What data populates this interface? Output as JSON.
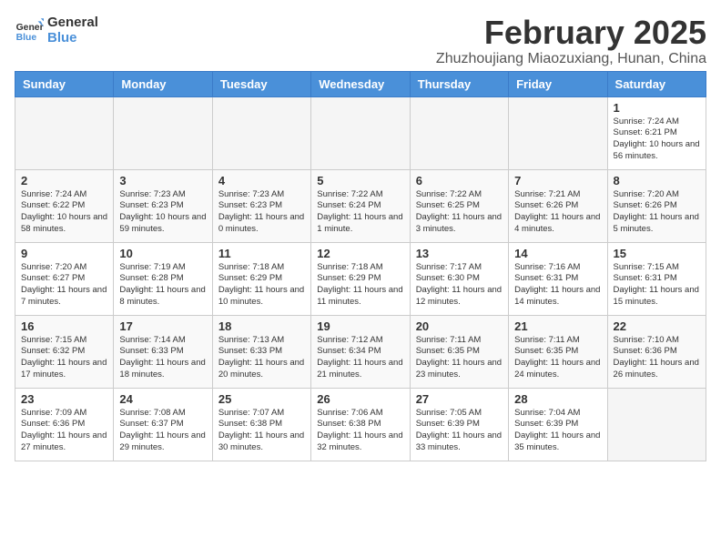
{
  "header": {
    "logo_line1": "General",
    "logo_line2": "Blue",
    "month_year": "February 2025",
    "location": "Zhuzhoujiang Miaozuxiang, Hunan, China"
  },
  "weekdays": [
    "Sunday",
    "Monday",
    "Tuesday",
    "Wednesday",
    "Thursday",
    "Friday",
    "Saturday"
  ],
  "weeks": [
    [
      {
        "day": "",
        "info": ""
      },
      {
        "day": "",
        "info": ""
      },
      {
        "day": "",
        "info": ""
      },
      {
        "day": "",
        "info": ""
      },
      {
        "day": "",
        "info": ""
      },
      {
        "day": "",
        "info": ""
      },
      {
        "day": "1",
        "info": "Sunrise: 7:24 AM\nSunset: 6:21 PM\nDaylight: 10 hours and 56 minutes."
      }
    ],
    [
      {
        "day": "2",
        "info": "Sunrise: 7:24 AM\nSunset: 6:22 PM\nDaylight: 10 hours and 58 minutes."
      },
      {
        "day": "3",
        "info": "Sunrise: 7:23 AM\nSunset: 6:23 PM\nDaylight: 10 hours and 59 minutes."
      },
      {
        "day": "4",
        "info": "Sunrise: 7:23 AM\nSunset: 6:23 PM\nDaylight: 11 hours and 0 minutes."
      },
      {
        "day": "5",
        "info": "Sunrise: 7:22 AM\nSunset: 6:24 PM\nDaylight: 11 hours and 1 minute."
      },
      {
        "day": "6",
        "info": "Sunrise: 7:22 AM\nSunset: 6:25 PM\nDaylight: 11 hours and 3 minutes."
      },
      {
        "day": "7",
        "info": "Sunrise: 7:21 AM\nSunset: 6:26 PM\nDaylight: 11 hours and 4 minutes."
      },
      {
        "day": "8",
        "info": "Sunrise: 7:20 AM\nSunset: 6:26 PM\nDaylight: 11 hours and 5 minutes."
      }
    ],
    [
      {
        "day": "9",
        "info": "Sunrise: 7:20 AM\nSunset: 6:27 PM\nDaylight: 11 hours and 7 minutes."
      },
      {
        "day": "10",
        "info": "Sunrise: 7:19 AM\nSunset: 6:28 PM\nDaylight: 11 hours and 8 minutes."
      },
      {
        "day": "11",
        "info": "Sunrise: 7:18 AM\nSunset: 6:29 PM\nDaylight: 11 hours and 10 minutes."
      },
      {
        "day": "12",
        "info": "Sunrise: 7:18 AM\nSunset: 6:29 PM\nDaylight: 11 hours and 11 minutes."
      },
      {
        "day": "13",
        "info": "Sunrise: 7:17 AM\nSunset: 6:30 PM\nDaylight: 11 hours and 12 minutes."
      },
      {
        "day": "14",
        "info": "Sunrise: 7:16 AM\nSunset: 6:31 PM\nDaylight: 11 hours and 14 minutes."
      },
      {
        "day": "15",
        "info": "Sunrise: 7:15 AM\nSunset: 6:31 PM\nDaylight: 11 hours and 15 minutes."
      }
    ],
    [
      {
        "day": "16",
        "info": "Sunrise: 7:15 AM\nSunset: 6:32 PM\nDaylight: 11 hours and 17 minutes."
      },
      {
        "day": "17",
        "info": "Sunrise: 7:14 AM\nSunset: 6:33 PM\nDaylight: 11 hours and 18 minutes."
      },
      {
        "day": "18",
        "info": "Sunrise: 7:13 AM\nSunset: 6:33 PM\nDaylight: 11 hours and 20 minutes."
      },
      {
        "day": "19",
        "info": "Sunrise: 7:12 AM\nSunset: 6:34 PM\nDaylight: 11 hours and 21 minutes."
      },
      {
        "day": "20",
        "info": "Sunrise: 7:11 AM\nSunset: 6:35 PM\nDaylight: 11 hours and 23 minutes."
      },
      {
        "day": "21",
        "info": "Sunrise: 7:11 AM\nSunset: 6:35 PM\nDaylight: 11 hours and 24 minutes."
      },
      {
        "day": "22",
        "info": "Sunrise: 7:10 AM\nSunset: 6:36 PM\nDaylight: 11 hours and 26 minutes."
      }
    ],
    [
      {
        "day": "23",
        "info": "Sunrise: 7:09 AM\nSunset: 6:36 PM\nDaylight: 11 hours and 27 minutes."
      },
      {
        "day": "24",
        "info": "Sunrise: 7:08 AM\nSunset: 6:37 PM\nDaylight: 11 hours and 29 minutes."
      },
      {
        "day": "25",
        "info": "Sunrise: 7:07 AM\nSunset: 6:38 PM\nDaylight: 11 hours and 30 minutes."
      },
      {
        "day": "26",
        "info": "Sunrise: 7:06 AM\nSunset: 6:38 PM\nDaylight: 11 hours and 32 minutes."
      },
      {
        "day": "27",
        "info": "Sunrise: 7:05 AM\nSunset: 6:39 PM\nDaylight: 11 hours and 33 minutes."
      },
      {
        "day": "28",
        "info": "Sunrise: 7:04 AM\nSunset: 6:39 PM\nDaylight: 11 hours and 35 minutes."
      },
      {
        "day": "",
        "info": ""
      }
    ]
  ]
}
